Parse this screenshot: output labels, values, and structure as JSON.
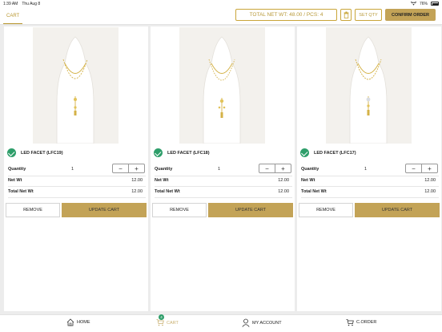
{
  "status": {
    "time": "1:39 AM",
    "date": "Thu Aug 8",
    "battery": "76%"
  },
  "header": {
    "tab_label": "CART",
    "net_weight_summary": "TOTAL NET WT: 48.00 / PCS: 4",
    "set_qty_label": "SET QTY",
    "confirm_label": "CONFIRM ORDER"
  },
  "cart_items": [
    {
      "name": "LED FACET (LFC19)",
      "quantity_label": "Quantity",
      "quantity": "1",
      "net_wt_label": "Net Wt",
      "net_wt": "12.00",
      "total_net_wt_label": "Total Net Wt",
      "total_net_wt": "12.00",
      "remove_label": "REMOVE",
      "update_label": "UPDATE CART"
    },
    {
      "name": "LED FACET (LFC18)",
      "quantity_label": "Quantity",
      "quantity": "1",
      "net_wt_label": "Net Wt",
      "net_wt": "12.00",
      "total_net_wt_label": "Total Net Wt",
      "total_net_wt": "12.00",
      "remove_label": "REMOVE",
      "update_label": "UPDATE CART"
    },
    {
      "name": "LED FACET (LFC17)",
      "quantity_label": "Quantity",
      "quantity": "1",
      "net_wt_label": "Net Wt",
      "net_wt": "12.00",
      "total_net_wt_label": "Total Net Wt",
      "total_net_wt": "12.00",
      "remove_label": "REMOVE",
      "update_label": "UPDATE CART"
    }
  ],
  "stepper": {
    "minus": "−",
    "plus": "+"
  },
  "bottom_nav": {
    "home": "HOME",
    "cart": "CART",
    "cart_badge": "4",
    "account": "MY ACCOUNT",
    "corder": "C.ORDER"
  },
  "colors": {
    "accent_gold": "#c3a357",
    "check_green": "#2e9e6a"
  }
}
